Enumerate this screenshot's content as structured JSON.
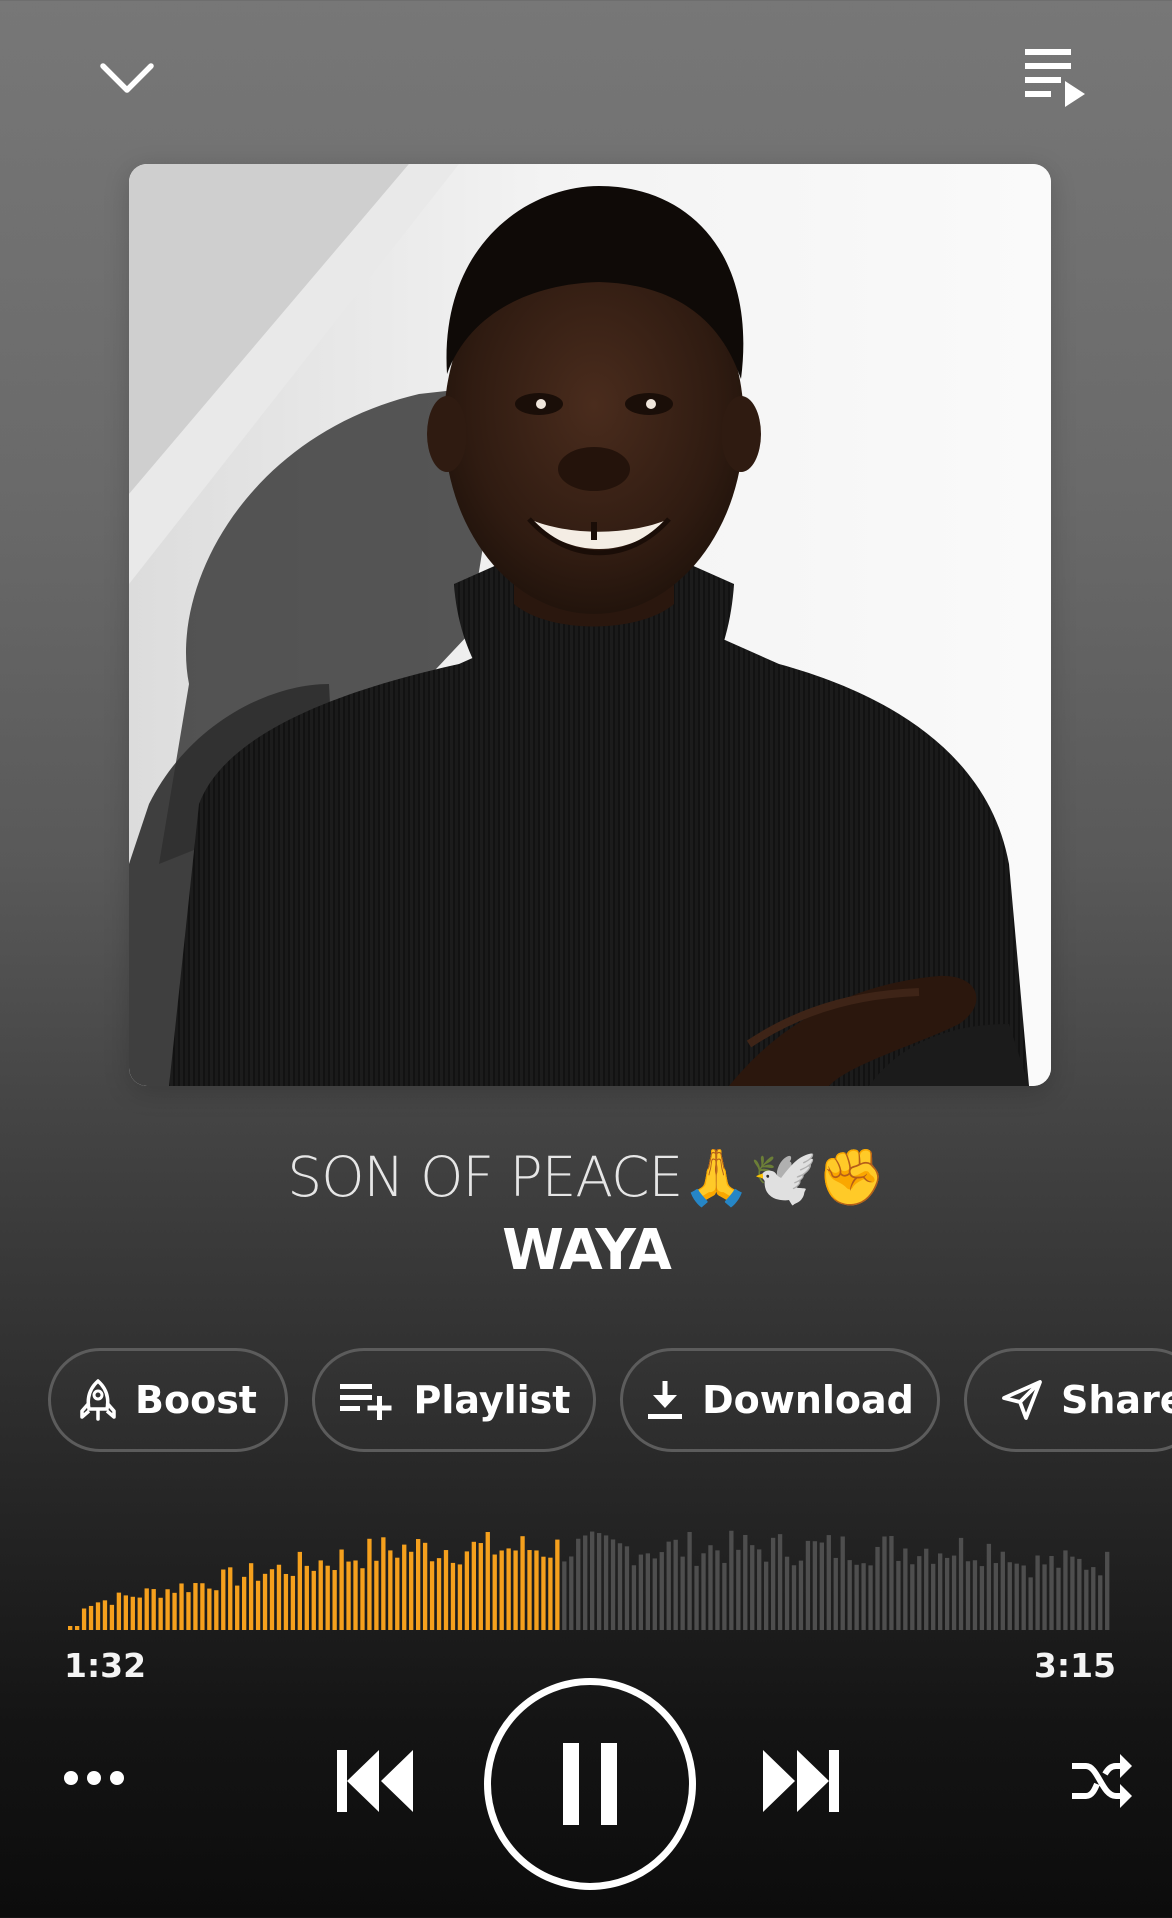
{
  "header": {
    "collapse_icon": "chevron-down-icon",
    "queue_icon": "queue-music-icon"
  },
  "track": {
    "title": "SON OF PEACE🙏🕊️✊",
    "artist": "WAYA"
  },
  "actions": [
    {
      "label": "Boost",
      "icon": "rocket-icon"
    },
    {
      "label": "Playlist",
      "icon": "playlist-add-icon"
    },
    {
      "label": "Download",
      "icon": "download-icon"
    },
    {
      "label": "Share",
      "icon": "send-icon"
    }
  ],
  "player": {
    "elapsed": "1:32",
    "duration": "3:15",
    "progress_fraction": 0.472,
    "state": "playing",
    "controls": [
      "more-icon",
      "skip-previous-icon",
      "pause-icon",
      "skip-next-icon",
      "shuffle-icon"
    ]
  },
  "colors": {
    "accent": "#f5a01d",
    "waveform_unplayed": "#4e4e4e",
    "pill_border": "#5c5c5c"
  }
}
